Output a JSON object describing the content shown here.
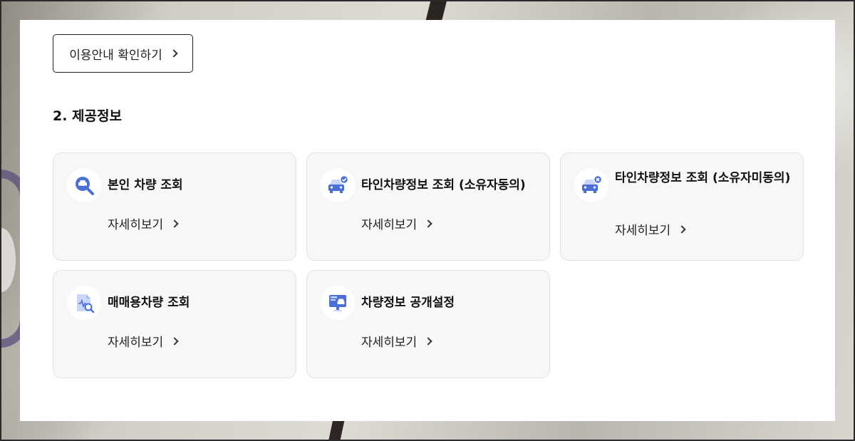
{
  "guide_button": {
    "label": "이용안내 확인하기"
  },
  "section": {
    "title": "2. 제공정보"
  },
  "cards": [
    {
      "title": "본인 차량 조회",
      "link": "자세히보기",
      "icon": "search-car-icon"
    },
    {
      "title": "타인차량정보 조회 (소유자동의)",
      "link": "자세히보기",
      "icon": "car-check-icon"
    },
    {
      "title": "타인차량정보 조회 (소유자미동의)",
      "link": "자세히보기",
      "icon": "car-x-icon"
    },
    {
      "title": "매매용차량 조회",
      "link": "자세히보기",
      "icon": "document-search-icon"
    },
    {
      "title": "차량정보 공개설정",
      "link": "자세히보기",
      "icon": "monitor-car-icon"
    }
  ],
  "colors": {
    "icon_blue": "#4a6fd8",
    "icon_light": "#c8d6f7",
    "card_bg": "#f7f7f7"
  }
}
